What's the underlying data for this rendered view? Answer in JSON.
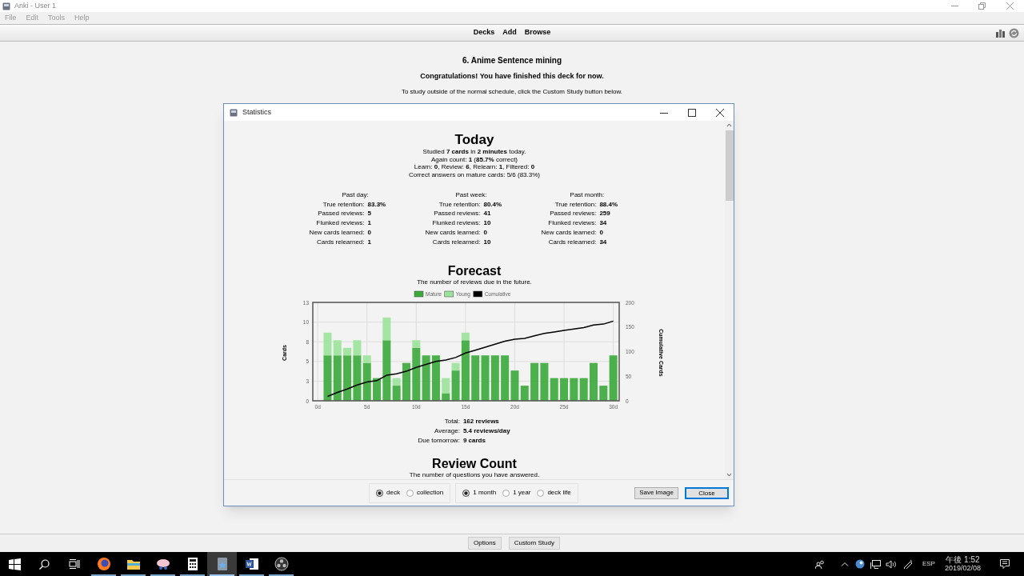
{
  "window": {
    "title": "Anki - User 1"
  },
  "menu": [
    "File",
    "Edit",
    "Tools",
    "Help"
  ],
  "toolbar": [
    "Decks",
    "Add",
    "Browse"
  ],
  "overview": {
    "deck_title": "6. Anime Sentence mining",
    "message": "Congratulations! You have finished this deck for now.",
    "hint": "To study outside of the normal schedule, click the Custom Study button below."
  },
  "statistics_dialog": {
    "title": "Statistics",
    "today": {
      "heading": "Today",
      "lines": [
        "Studied **7 cards** in **2 minutes** today.",
        "Again count: **1** (**85.7%** correct)",
        "Learn: **0**, Review: **6**, Relearn: **1**, Filtered: **0**",
        "Correct answers on mature cards: 5/6 (83.3%)"
      ]
    },
    "periods": [
      {
        "title": "Past day:",
        "rows": [
          {
            "label": "True retention:",
            "value": "83.3%"
          },
          {
            "label": "Passed reviews:",
            "value": "5"
          },
          {
            "label": "Flunked reviews:",
            "value": "1"
          },
          {
            "label": "New cards learned:",
            "value": "0"
          },
          {
            "label": "Cards relearned:",
            "value": "1"
          }
        ]
      },
      {
        "title": "Past week:",
        "rows": [
          {
            "label": "True retention:",
            "value": "80.4%"
          },
          {
            "label": "Passed reviews:",
            "value": "41"
          },
          {
            "label": "Flunked reviews:",
            "value": "10"
          },
          {
            "label": "New cards learned:",
            "value": "0"
          },
          {
            "label": "Cards relearned:",
            "value": "10"
          }
        ]
      },
      {
        "title": "Past month:",
        "rows": [
          {
            "label": "True retention:",
            "value": "88.4%"
          },
          {
            "label": "Passed reviews:",
            "value": "259"
          },
          {
            "label": "Flunked reviews:",
            "value": "34"
          },
          {
            "label": "New cards learned:",
            "value": "0"
          },
          {
            "label": "Cards relearned:",
            "value": "34"
          }
        ]
      }
    ],
    "forecast": {
      "heading": "Forecast",
      "subtitle": "The number of reviews due in the future.",
      "chart_data": {
        "type": "bar",
        "stacked": true,
        "ylabel": "Cards",
        "x": [
          1,
          2,
          3,
          4,
          5,
          6,
          7,
          8,
          9,
          10,
          11,
          12,
          13,
          14,
          15,
          16,
          17,
          18,
          19,
          20,
          21,
          22,
          23,
          24,
          25,
          26,
          27,
          28,
          29,
          30
        ],
        "series": [
          {
            "name": "Mature",
            "color": "#3aaa3a",
            "values": [
              6,
              6,
              6,
              6,
              5,
              3,
              8,
              2,
              5,
              7,
              6,
              6,
              1,
              4,
              8,
              6,
              6,
              6,
              6,
              4,
              2,
              5,
              5,
              3,
              3,
              3,
              3,
              5,
              2,
              6
            ]
          },
          {
            "name": "Young",
            "color": "#9be39b",
            "values": [
              3,
              2,
              1,
              2,
              1,
              0,
              3,
              1,
              0,
              1,
              0,
              0,
              2,
              1,
              1,
              0,
              0,
              0,
              0,
              0,
              0,
              0,
              0,
              0,
              0,
              0,
              0,
              0,
              0,
              0
            ]
          },
          {
            "name": "Cumulative",
            "color": "#000000",
            "type": "line",
            "axis": "y2",
            "values": [
              9,
              17,
              24,
              32,
              38,
              41,
              52,
              55,
              60,
              68,
              74,
              80,
              83,
              88,
              97,
              103,
              109,
              115,
              121,
              125,
              127,
              132,
              137,
              140,
              143,
              146,
              149,
              154,
              156,
              162
            ]
          }
        ],
        "xlim": [
          -0.5,
          30.6
        ],
        "ylim": [
          0,
          13
        ],
        "y2lim": [
          0,
          200
        ],
        "y2label": "Cumulative Cards",
        "y2ticks": [
          {
            "value": 0,
            "label": "0"
          },
          {
            "value": 50,
            "label": "50"
          },
          {
            "value": 100,
            "label": "100"
          },
          {
            "value": 150,
            "label": "150"
          },
          {
            "value": 200,
            "label": "200"
          }
        ],
        "grid": true,
        "legend": true,
        "xticks": [
          {
            "value": 0,
            "label": "0d"
          },
          {
            "value": 5,
            "label": "5d"
          },
          {
            "value": 10,
            "label": "10d"
          },
          {
            "value": 15,
            "label": "15d"
          },
          {
            "value": 20,
            "label": "20d"
          },
          {
            "value": 25,
            "label": "25d"
          },
          {
            "value": 30,
            "label": "30d"
          }
        ],
        "yticks": [
          {
            "value": 0,
            "label": "0"
          },
          {
            "value": 2.6,
            "label": "3"
          },
          {
            "value": 5.2,
            "label": "5"
          },
          {
            "value": 7.8,
            "label": "8"
          },
          {
            "value": 10.4,
            "label": "10"
          },
          {
            "value": 13,
            "label": "13"
          }
        ]
      },
      "summary": [
        {
          "label": "Total:",
          "value": "162 reviews"
        },
        {
          "label": "Average:",
          "value": "5.4 reviews/day"
        },
        {
          "label": "Due tomorrow:",
          "value": "9 cards"
        }
      ]
    },
    "review_count": {
      "heading": "Review Count",
      "subtitle": "The number of questions you have answered."
    },
    "scope_options": [
      {
        "label": "deck",
        "selected": true
      },
      {
        "label": "collection",
        "selected": false
      }
    ],
    "period_options": [
      {
        "label": "1 month",
        "selected": true
      },
      {
        "label": "1 year",
        "selected": false
      },
      {
        "label": "deck life",
        "selected": false
      }
    ],
    "buttons": [
      {
        "label": "Save Image",
        "default": false
      },
      {
        "label": "Close",
        "default": true
      }
    ]
  },
  "bottom_buttons": [
    "Options",
    "Custom Study"
  ],
  "taskbar": {
    "apps": [
      {
        "kind": "browser",
        "selected": false
      },
      {
        "kind": "folder",
        "selected": false
      },
      {
        "kind": "snip",
        "selected": false
      },
      {
        "kind": "calculator",
        "selected": false
      },
      {
        "kind": "anki",
        "selected": true
      },
      {
        "kind": "word",
        "selected": false
      },
      {
        "kind": "obs",
        "selected": false
      }
    ],
    "language": "ESP",
    "time": "午後 1:52",
    "date": "2019/02/08"
  }
}
